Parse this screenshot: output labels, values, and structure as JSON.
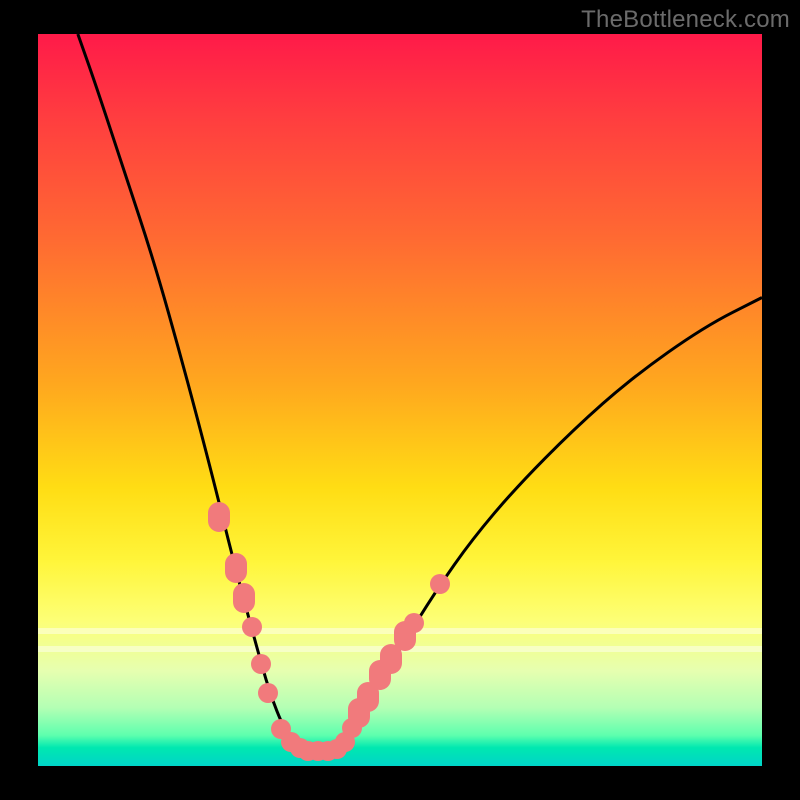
{
  "watermark": "TheBottleneck.com",
  "colors": {
    "frame": "#000000",
    "curve": "#000000",
    "marker": "#f17a7c"
  },
  "chart_data": {
    "type": "line",
    "title": "",
    "xlabel": "",
    "ylabel": "",
    "xlim": [
      0,
      100
    ],
    "ylim": [
      0,
      100
    ],
    "grid": false,
    "curve_points": [
      {
        "x": 5.5,
        "y": 100
      },
      {
        "x": 8,
        "y": 93
      },
      {
        "x": 12,
        "y": 81
      },
      {
        "x": 16,
        "y": 69
      },
      {
        "x": 20,
        "y": 55
      },
      {
        "x": 24,
        "y": 40
      },
      {
        "x": 27,
        "y": 28
      },
      {
        "x": 30,
        "y": 17
      },
      {
        "x": 32,
        "y": 10
      },
      {
        "x": 34,
        "y": 5
      },
      {
        "x": 36,
        "y": 2.2
      },
      {
        "x": 38,
        "y": 1.8
      },
      {
        "x": 40,
        "y": 2
      },
      {
        "x": 42,
        "y": 4
      },
      {
        "x": 45,
        "y": 8
      },
      {
        "x": 50,
        "y": 16
      },
      {
        "x": 55,
        "y": 24
      },
      {
        "x": 60,
        "y": 31
      },
      {
        "x": 66,
        "y": 38
      },
      {
        "x": 74,
        "y": 46
      },
      {
        "x": 82,
        "y": 53
      },
      {
        "x": 92,
        "y": 60
      },
      {
        "x": 100,
        "y": 64
      }
    ],
    "markers_left": [
      {
        "x": 25.0,
        "y": 34
      },
      {
        "x": 27.3,
        "y": 27
      },
      {
        "x": 28.4,
        "y": 23
      },
      {
        "x": 29.5,
        "y": 19
      },
      {
        "x": 30.8,
        "y": 14
      },
      {
        "x": 31.8,
        "y": 10
      },
      {
        "x": 33.6,
        "y": 5
      },
      {
        "x": 35.0,
        "y": 3.3
      },
      {
        "x": 36.2,
        "y": 2.5
      }
    ],
    "markers_bottom": [
      {
        "x": 37.3,
        "y": 2.0
      },
      {
        "x": 38.7,
        "y": 2.0
      },
      {
        "x": 40.0,
        "y": 2.0
      },
      {
        "x": 41.3,
        "y": 2.3
      }
    ],
    "markers_right": [
      {
        "x": 42.4,
        "y": 3.3
      },
      {
        "x": 43.4,
        "y": 5.2
      },
      {
        "x": 44.4,
        "y": 7.3
      },
      {
        "x": 45.6,
        "y": 9.4
      },
      {
        "x": 47.3,
        "y": 12.5
      },
      {
        "x": 48.7,
        "y": 14.6
      },
      {
        "x": 50.7,
        "y": 17.7
      },
      {
        "x": 52.0,
        "y": 19.5
      },
      {
        "x": 55.5,
        "y": 24.8
      }
    ],
    "white_bands_y": [
      81.5,
      83.5
    ]
  }
}
